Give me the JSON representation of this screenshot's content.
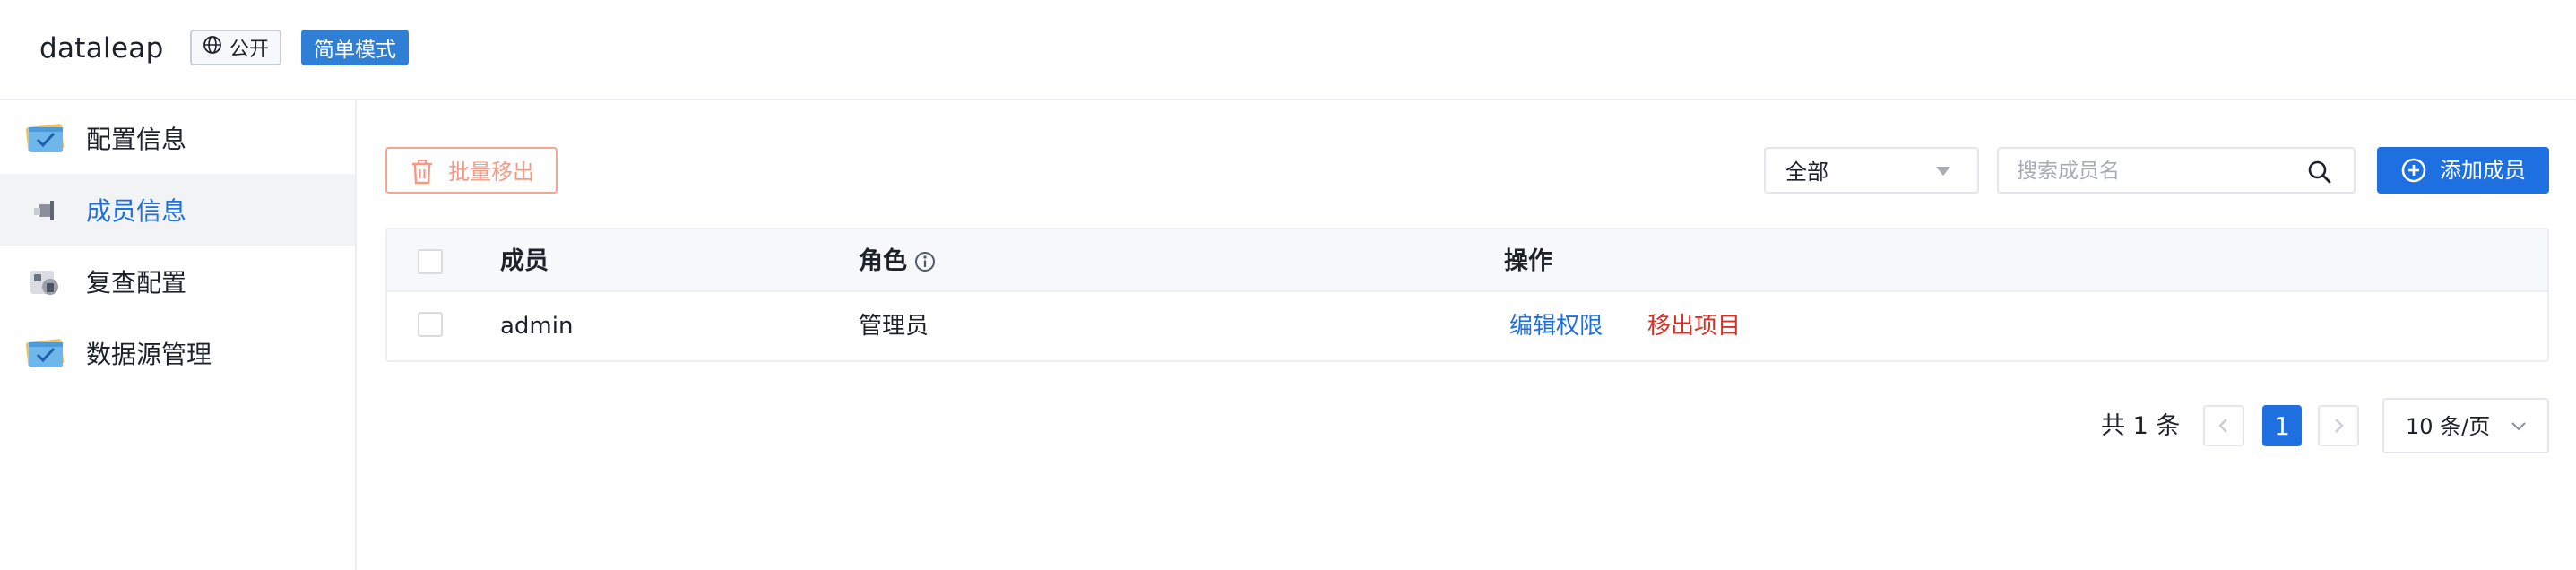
{
  "header": {
    "app_title": "dataleap",
    "visibility_badge": "公开",
    "mode_badge": "简单模式"
  },
  "sidebar": {
    "items": [
      {
        "label": "配置信息",
        "icon": "config-info-icon",
        "active": false
      },
      {
        "label": "成员信息",
        "icon": "member-info-icon",
        "active": true
      },
      {
        "label": "复查配置",
        "icon": "review-config-icon",
        "active": false
      },
      {
        "label": "数据源管理",
        "icon": "datasource-management-icon",
        "active": false
      }
    ]
  },
  "toolbar": {
    "batch_remove_label": "批量移出",
    "role_filter_value": "全部",
    "search_placeholder": "搜索成员名",
    "search_value": "",
    "add_member_label": "添加成员"
  },
  "table": {
    "columns": [
      "成员",
      "角色",
      "操作"
    ],
    "rows": [
      {
        "member": "admin",
        "role": "管理员",
        "actions": [
          "编辑权限",
          "移出项目"
        ]
      }
    ]
  },
  "pagination": {
    "total_text": "共 1 条",
    "current_page": "1",
    "page_size_label": "10 条/页"
  },
  "colors": {
    "primary": "#1e6fe0",
    "mode_badge_bg": "#2f7fd6",
    "danger": "#d93026",
    "batch_remove": "#f39a86"
  }
}
